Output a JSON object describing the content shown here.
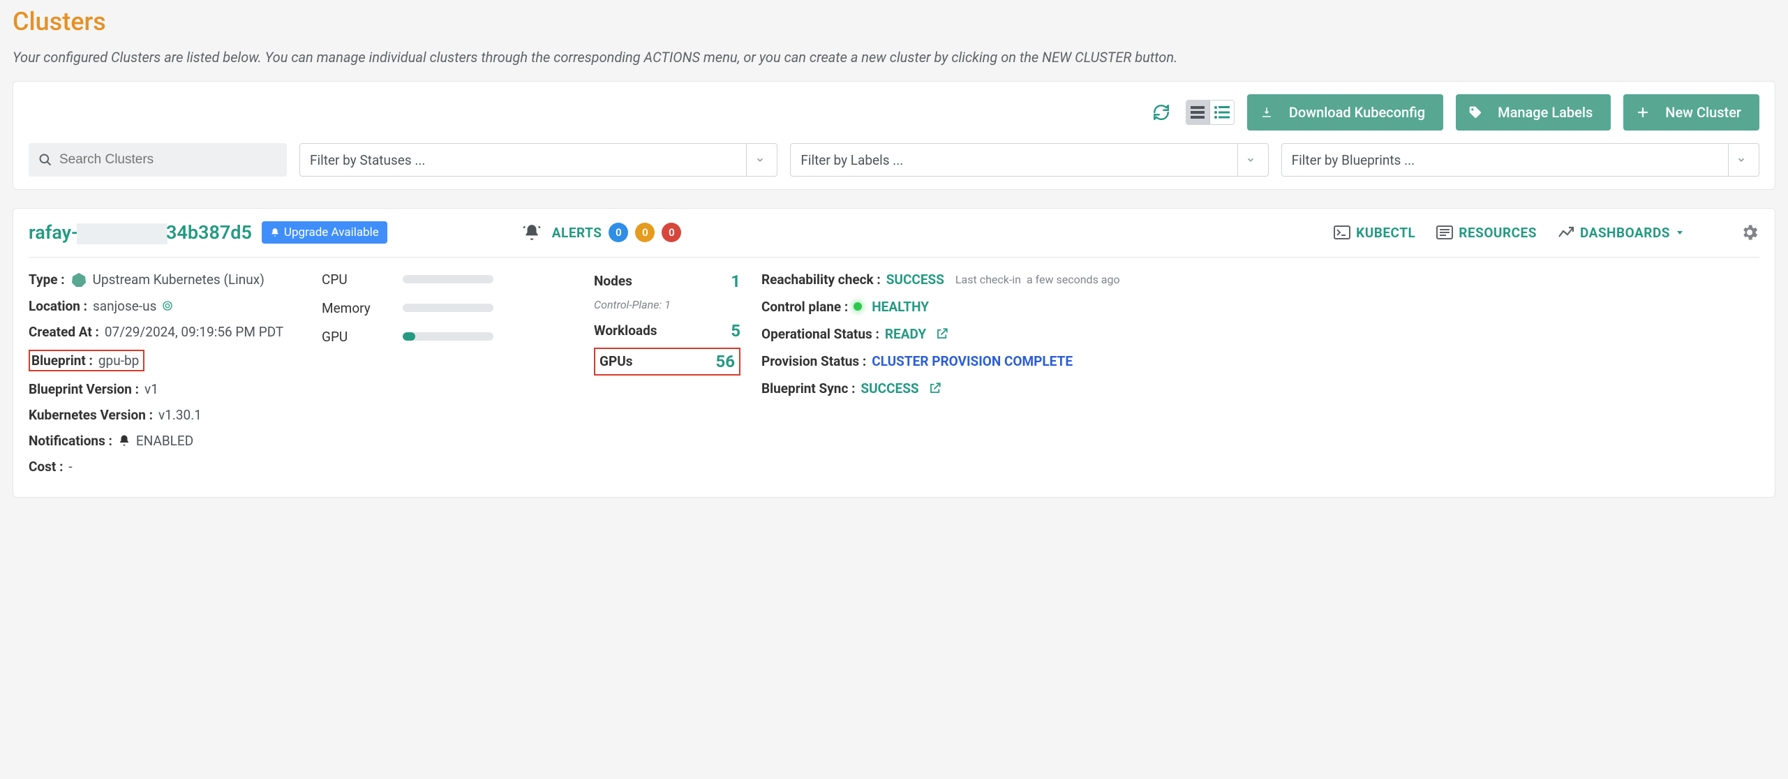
{
  "page": {
    "title": "Clusters",
    "subtitle": "Your configured Clusters are listed below. You can manage individual clusters through the corresponding ACTIONS menu, or you can create a new cluster by clicking on the NEW CLUSTER button."
  },
  "toolbar": {
    "buttons": {
      "download": "Download Kubeconfig",
      "labels": "Manage Labels",
      "new": "New Cluster"
    },
    "search_placeholder": "Search Clusters",
    "filters": {
      "status": "Filter by Statuses ...",
      "labels": "Filter by Labels ...",
      "blueprints": "Filter by Blueprints ..."
    }
  },
  "cluster": {
    "name_prefix": "rafay-",
    "name_suffix": "34b387d5",
    "upgrade_label": "Upgrade Available",
    "alerts_label": "ALERTS",
    "alerts": {
      "info": "0",
      "warn": "0",
      "error": "0"
    },
    "links": {
      "kubectl": "KUBECTL",
      "resources": "RESOURCES",
      "dashboards": "DASHBOARDS"
    },
    "left": {
      "type_k": "Type :",
      "type_v": "Upstream Kubernetes (Linux)",
      "location_k": "Location :",
      "location_v": "sanjose-us",
      "created_k": "Created At :",
      "created_v": "07/29/2024, 09:19:56 PM PDT",
      "blueprint_k": "Blueprint :",
      "blueprint_v": "gpu-bp",
      "bp_ver_k": "Blueprint Version :",
      "bp_ver_v": "v1",
      "k8s_ver_k": "Kubernetes Version :",
      "k8s_ver_v": "v1.30.1",
      "notif_k": "Notifications :",
      "notif_v": "ENABLED",
      "cost_k": "Cost :",
      "cost_v": "-"
    },
    "meters": {
      "cpu": "CPU",
      "mem": "Memory",
      "gpu": "GPU",
      "gpu_fill_pct": 14
    },
    "stats": {
      "nodes_k": "Nodes",
      "nodes_v": "1",
      "nodes_sub": "Control-Plane: 1",
      "workloads_k": "Workloads",
      "workloads_v": "5",
      "gpus_k": "GPUs",
      "gpus_v": "56"
    },
    "status": {
      "reach_k": "Reachability check :",
      "reach_v": "SUCCESS",
      "last_check_label": "Last check-in",
      "last_check_v": "a few seconds ago",
      "cp_k": "Control plane :",
      "cp_v": "HEALTHY",
      "op_k": "Operational Status :",
      "op_v": "READY",
      "prov_k": "Provision Status :",
      "prov_v": "CLUSTER PROVISION COMPLETE",
      "sync_k": "Blueprint Sync :",
      "sync_v": "SUCCESS"
    }
  }
}
